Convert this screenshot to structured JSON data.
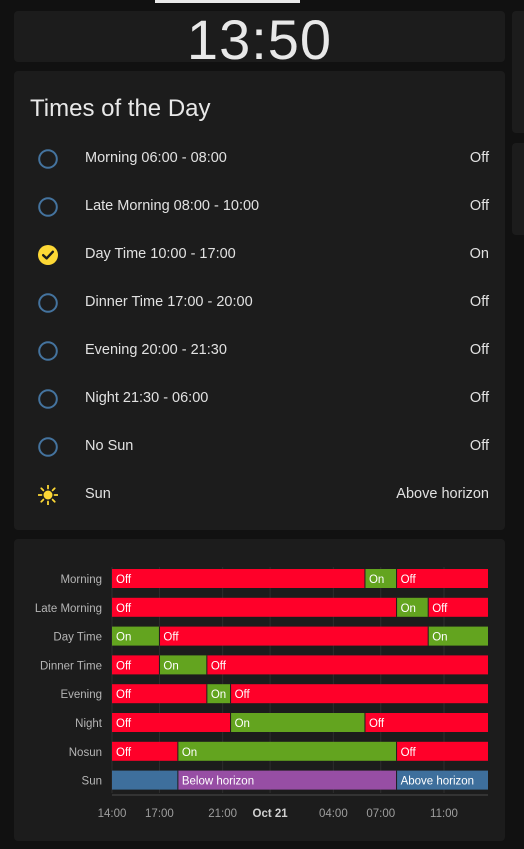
{
  "clock": {
    "time": "13:50"
  },
  "entities": {
    "title": "Times of the Day",
    "rows": [
      {
        "name": "Morning 06:00 - 08:00",
        "state": "Off",
        "icon": "circle-outline-icon"
      },
      {
        "name": "Late Morning 08:00 - 10:00",
        "state": "Off",
        "icon": "circle-outline-icon"
      },
      {
        "name": "Day Time 10:00 - 17:00",
        "state": "On",
        "icon": "check-circle-icon"
      },
      {
        "name": "Dinner Time 17:00 - 20:00",
        "state": "Off",
        "icon": "circle-outline-icon"
      },
      {
        "name": "Evening 20:00 - 21:30",
        "state": "Off",
        "icon": "circle-outline-icon"
      },
      {
        "name": "Night 21:30 - 06:00",
        "state": "Off",
        "icon": "circle-outline-icon"
      },
      {
        "name": "No Sun",
        "state": "Off",
        "icon": "circle-outline-icon"
      },
      {
        "name": "Sun",
        "state": "Above horizon",
        "icon": "sun-icon"
      }
    ]
  },
  "colors": {
    "on": "#63a41f",
    "off": "#ff0029",
    "below_horizon": "#974ea4",
    "above_horizon": "#3e6f9c",
    "active_icon": "#fdd835",
    "inactive_icon": "#44739e"
  },
  "timeline": {
    "range": [
      "14:00",
      "11:00+1"
    ],
    "tick_labels": [
      "14:00",
      "17:00",
      "21:00",
      "Oct 21",
      "04:00",
      "07:00",
      "11:00"
    ],
    "ticks": [
      "14:00",
      "17:00",
      "21:00",
      "00:00+1",
      "04:00+1",
      "07:00+1",
      "11:00+1"
    ],
    "rows": [
      {
        "label": "Morning",
        "segments": [
          {
            "state": "Off",
            "start": "14:00",
            "end": "06:00+1"
          },
          {
            "state": "On",
            "start": "06:00+1",
            "end": "08:00+1"
          },
          {
            "state": "Off",
            "start": "08:00+1",
            "end": "13:50+1"
          }
        ]
      },
      {
        "label": "Late Morning",
        "segments": [
          {
            "state": "Off",
            "start": "14:00",
            "end": "08:00+1"
          },
          {
            "state": "On",
            "start": "08:00+1",
            "end": "10:00+1"
          },
          {
            "state": "Off",
            "start": "10:00+1",
            "end": "13:50+1"
          }
        ]
      },
      {
        "label": "Day Time",
        "segments": [
          {
            "state": "On",
            "start": "14:00",
            "end": "17:00"
          },
          {
            "state": "Off",
            "start": "17:00",
            "end": "10:00+1"
          },
          {
            "state": "On",
            "start": "10:00+1",
            "end": "13:50+1"
          }
        ]
      },
      {
        "label": "Dinner Time",
        "segments": [
          {
            "state": "Off",
            "start": "14:00",
            "end": "17:00"
          },
          {
            "state": "On",
            "start": "17:00",
            "end": "20:00"
          },
          {
            "state": "Off",
            "start": "20:00",
            "end": "13:50+1"
          }
        ]
      },
      {
        "label": "Evening",
        "segments": [
          {
            "state": "Off",
            "start": "14:00",
            "end": "20:00"
          },
          {
            "state": "On",
            "start": "20:00",
            "end": "21:30"
          },
          {
            "state": "Off",
            "start": "21:30",
            "end": "13:50+1"
          }
        ]
      },
      {
        "label": "Night",
        "segments": [
          {
            "state": "Off",
            "start": "14:00",
            "end": "21:30"
          },
          {
            "state": "On",
            "start": "21:30",
            "end": "06:00+1"
          },
          {
            "state": "Off",
            "start": "06:00+1",
            "end": "13:50+1"
          }
        ]
      },
      {
        "label": "Nosun",
        "segments": [
          {
            "state": "Off",
            "start": "14:00",
            "end": "18:10"
          },
          {
            "state": "On",
            "start": "18:10",
            "end": "08:00+1"
          },
          {
            "state": "Off",
            "start": "08:00+1",
            "end": "13:50+1"
          }
        ]
      },
      {
        "label": "Sun",
        "segments": [
          {
            "state": "",
            "start": "14:00",
            "end": "18:10"
          },
          {
            "state": "Below horizon",
            "start": "18:10",
            "end": "08:00+1"
          },
          {
            "state": "Above horizon",
            "start": "08:00+1",
            "end": "13:50+1"
          }
        ]
      }
    ]
  }
}
